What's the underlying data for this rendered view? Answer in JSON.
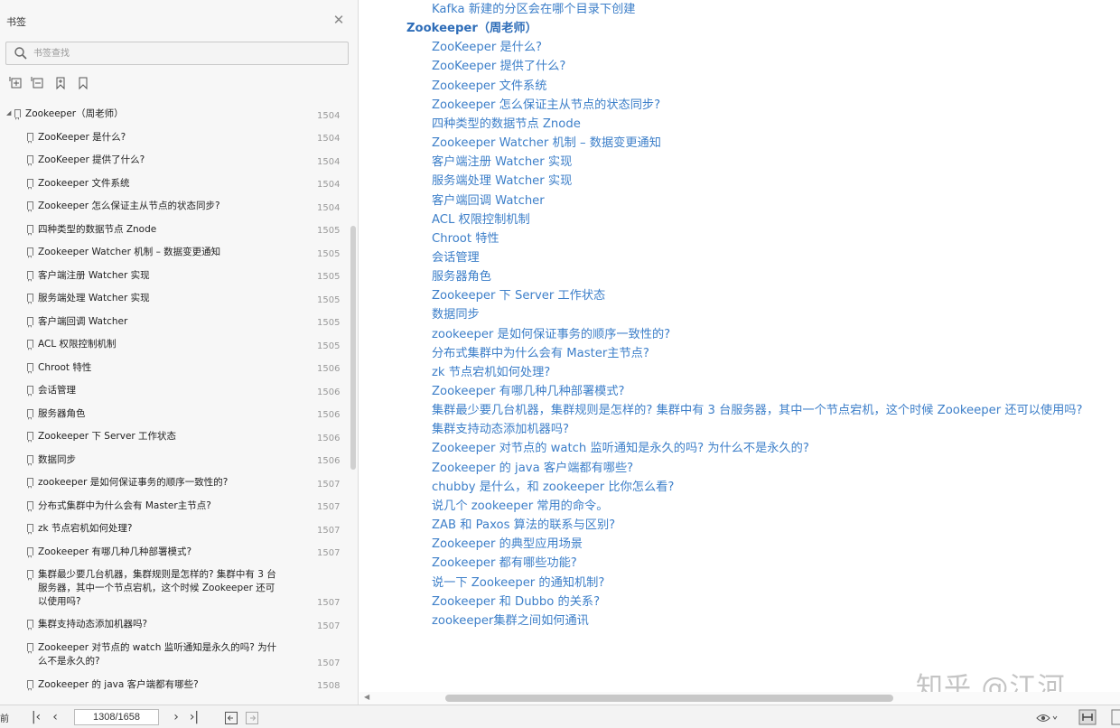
{
  "sidebar": {
    "title": "书签",
    "close_icon": "close-icon",
    "search": {
      "placeholder": "书签查找",
      "value": ""
    },
    "tools": [
      "expand-all-icon",
      "collapse-all-icon",
      "add-bookmark-icon",
      "bookmark-icon"
    ],
    "items": [
      {
        "label": "Zookeeper（周老师）",
        "page": "1504",
        "level": 0
      },
      {
        "label": "ZooKeeper 是什么?",
        "page": "1504",
        "level": 1
      },
      {
        "label": "ZooKeeper 提供了什么?",
        "page": "1504",
        "level": 1
      },
      {
        "label": "Zookeeper 文件系统",
        "page": "1504",
        "level": 1
      },
      {
        "label": "Zookeeper 怎么保证主从节点的状态同步?",
        "page": "1504",
        "level": 1
      },
      {
        "label": "四种类型的数据节点 Znode",
        "page": "1505",
        "level": 1
      },
      {
        "label": "Zookeeper Watcher 机制 – 数据变更通知",
        "page": "1505",
        "level": 1
      },
      {
        "label": "客户端注册 Watcher 实现",
        "page": "1505",
        "level": 1
      },
      {
        "label": "服务端处理 Watcher 实现",
        "page": "1505",
        "level": 1
      },
      {
        "label": "客户端回调 Watcher",
        "page": "1505",
        "level": 1
      },
      {
        "label": "ACL 权限控制机制",
        "page": "1505",
        "level": 1
      },
      {
        "label": "Chroot 特性",
        "page": "1506",
        "level": 1
      },
      {
        "label": "会话管理",
        "page": "1506",
        "level": 1
      },
      {
        "label": "服务器角色",
        "page": "1506",
        "level": 1
      },
      {
        "label": "Zookeeper 下 Server 工作状态",
        "page": "1506",
        "level": 1
      },
      {
        "label": "数据同步",
        "page": "1506",
        "level": 1
      },
      {
        "label": "zookeeper 是如何保证事务的顺序一致性的?",
        "page": "1507",
        "level": 1
      },
      {
        "label": "分布式集群中为什么会有 Master主节点?",
        "page": "1507",
        "level": 1
      },
      {
        "label": "zk 节点宕机如何处理?",
        "page": "1507",
        "level": 1
      },
      {
        "label": "Zookeeper 有哪几种几种部署模式?",
        "page": "1507",
        "level": 1
      },
      {
        "label": "集群最少要几台机器，集群规则是怎样的? 集群中有 3 台服务器，其中一个节点宕机，这个时候 Zookeeper 还可以使用吗?",
        "page": "1507",
        "level": 1
      },
      {
        "label": "集群支持动态添加机器吗?",
        "page": "1507",
        "level": 1
      },
      {
        "label": "Zookeeper 对节点的 watch 监听通知是永久的吗? 为什么不是永久的?",
        "page": "1507",
        "level": 1
      },
      {
        "label": "Zookeeper 的 java 客户端都有哪些?",
        "page": "1508",
        "level": 1
      }
    ]
  },
  "document": {
    "lines": [
      {
        "text": "Kafka 新建的分区会在哪个目录下创建",
        "head": false
      },
      {
        "text": "Zookeeper（周老师）",
        "head": true
      },
      {
        "text": "ZooKeeper 是什么?",
        "head": false
      },
      {
        "text": "ZooKeeper 提供了什么?",
        "head": false
      },
      {
        "text": "Zookeeper 文件系统",
        "head": false
      },
      {
        "text": "Zookeeper 怎么保证主从节点的状态同步?",
        "head": false
      },
      {
        "text": "四种类型的数据节点 Znode",
        "head": false
      },
      {
        "text": "Zookeeper Watcher 机制 – 数据变更通知",
        "head": false
      },
      {
        "text": "客户端注册 Watcher 实现",
        "head": false
      },
      {
        "text": "服务端处理 Watcher 实现",
        "head": false
      },
      {
        "text": "客户端回调 Watcher",
        "head": false
      },
      {
        "text": "ACL 权限控制机制",
        "head": false
      },
      {
        "text": "Chroot 特性",
        "head": false
      },
      {
        "text": "会话管理",
        "head": false
      },
      {
        "text": "服务器角色",
        "head": false
      },
      {
        "text": "Zookeeper 下 Server 工作状态",
        "head": false
      },
      {
        "text": "数据同步",
        "head": false
      },
      {
        "text": "zookeeper 是如何保证事务的顺序一致性的?",
        "head": false
      },
      {
        "text": "分布式集群中为什么会有 Master主节点?",
        "head": false
      },
      {
        "text": "zk 节点宕机如何处理?",
        "head": false
      },
      {
        "text": "Zookeeper 有哪几种几种部署模式?",
        "head": false
      },
      {
        "text": "集群最少要几台机器，集群规则是怎样的? 集群中有 3 台服务器，其中一个节点宕机，这个时候 Zookeeper 还可以使用吗?",
        "head": false
      },
      {
        "text": "集群支持动态添加机器吗?",
        "head": false
      },
      {
        "text": "Zookeeper 对节点的 watch 监听通知是永久的吗? 为什么不是永久的?",
        "head": false
      },
      {
        "text": "Zookeeper 的 java 客户端都有哪些?",
        "head": false
      },
      {
        "text": "chubby 是什么，和 zookeeper 比你怎么看?",
        "head": false
      },
      {
        "text": "说几个 zookeeper 常用的命令。",
        "head": false
      },
      {
        "text": "ZAB 和 Paxos 算法的联系与区别?",
        "head": false
      },
      {
        "text": "Zookeeper 的典型应用场景",
        "head": false
      },
      {
        "text": "Zookeeper 都有哪些功能?",
        "head": false
      },
      {
        "text": "说一下 Zookeeper 的通知机制?",
        "head": false
      },
      {
        "text": "Zookeeper 和 Dubbo 的关系?",
        "head": false
      },
      {
        "text": "zookeeper集群之间如何通讯",
        "head": false
      }
    ],
    "watermark": "知乎 @江河"
  },
  "statusbar": {
    "left_label": "前",
    "page_indicator": "1308/1658",
    "icons": [
      "first-page-icon",
      "prev-page-icon",
      "next-page-icon",
      "last-page-icon",
      "back-icon",
      "forward-icon",
      "eye-icon",
      "page-layout-icon",
      "fit-icon"
    ]
  },
  "colors": {
    "link": "#3d7fc9",
    "sidebar_bg": "#f7f7f7",
    "status_bg": "#f3f3f3"
  }
}
